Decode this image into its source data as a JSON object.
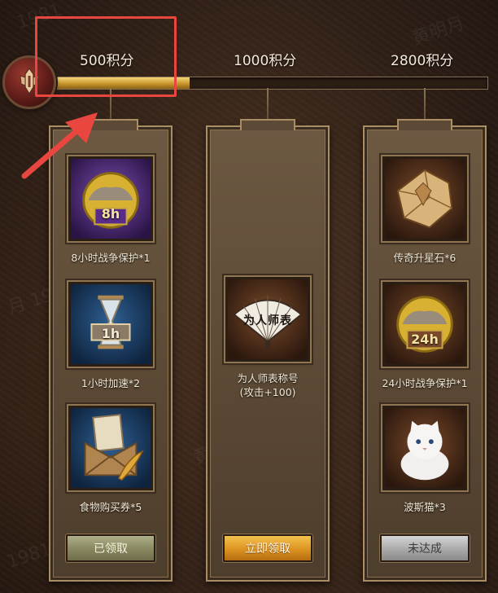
{
  "progress": {
    "milestones": [
      "500积分",
      "1000积分",
      "2800积分"
    ],
    "fill_fraction": 0.32
  },
  "columns": [
    {
      "items": [
        {
          "label": "8小时战争保护*1",
          "icon": "war-protection-8h-icon",
          "badge": "8h"
        },
        {
          "label": "1小时加速*2",
          "icon": "speedup-1h-icon",
          "badge": "1h"
        },
        {
          "label": "食物购买券*5",
          "icon": "food-voucher-icon"
        }
      ],
      "button": "已领取"
    },
    {
      "items": [
        {
          "label": "为人师表称号",
          "sublabel": "(攻击+100)",
          "icon": "title-fan-icon",
          "fan_text": "为人师表"
        }
      ],
      "button": "立即领取"
    },
    {
      "items": [
        {
          "label": "传奇升星石*6",
          "icon": "legend-star-stone-icon"
        },
        {
          "label": "24小时战争保护*1",
          "icon": "war-protection-24h-icon",
          "badge": "24h"
        },
        {
          "label": "波斯猫*3",
          "icon": "persian-cat-icon"
        }
      ],
      "button": "未达成"
    }
  ],
  "colors": {
    "highlight": "#e8463f",
    "progress_fill": "#c9962c",
    "claim_button": "#dc9321"
  }
}
